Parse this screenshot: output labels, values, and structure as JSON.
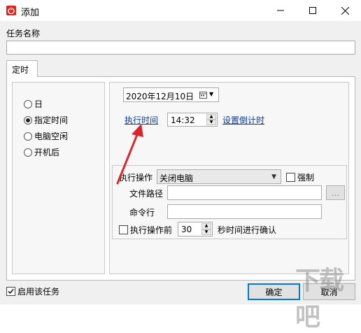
{
  "window": {
    "title": "添加",
    "app_icon": "power-icon",
    "controls": [
      "minimize-icon",
      "maximize-icon",
      "close-icon"
    ]
  },
  "task_name": {
    "label": "任务名称",
    "value": ""
  },
  "tab": {
    "label": "定时"
  },
  "schedule_modes": {
    "selected": "指定时间",
    "options": [
      "日",
      "指定时间",
      "电脑空闲",
      "开机后"
    ]
  },
  "date_picker": {
    "value": "2020年12月10日",
    "icon": "calendar-icon"
  },
  "time": {
    "link_label": "执行时间",
    "value": "14:32",
    "countdown_link": "设置倒计时"
  },
  "action": {
    "label": "执行操作",
    "selected": "关闭电脑",
    "force_label": "强制",
    "force_checked": false,
    "file_path_label": "文件路径",
    "file_path_value": "",
    "browse_label": "...",
    "command_label": "命令行",
    "command_value": "",
    "confirm_checked": false,
    "confirm_prefix": "执行操作前",
    "confirm_seconds": "30",
    "confirm_suffix": "秒时间进行确认"
  },
  "footer": {
    "enable_label": "启用该任务",
    "enable_checked": true,
    "ok_label": "确定",
    "cancel_label": "取消"
  },
  "watermark": {
    "text": "下载吧"
  },
  "colors": {
    "app_icon": "#d9251c",
    "link": "#0b3a94",
    "annotation_arrow": "#d9252c",
    "focus_border": "#0078d7"
  }
}
